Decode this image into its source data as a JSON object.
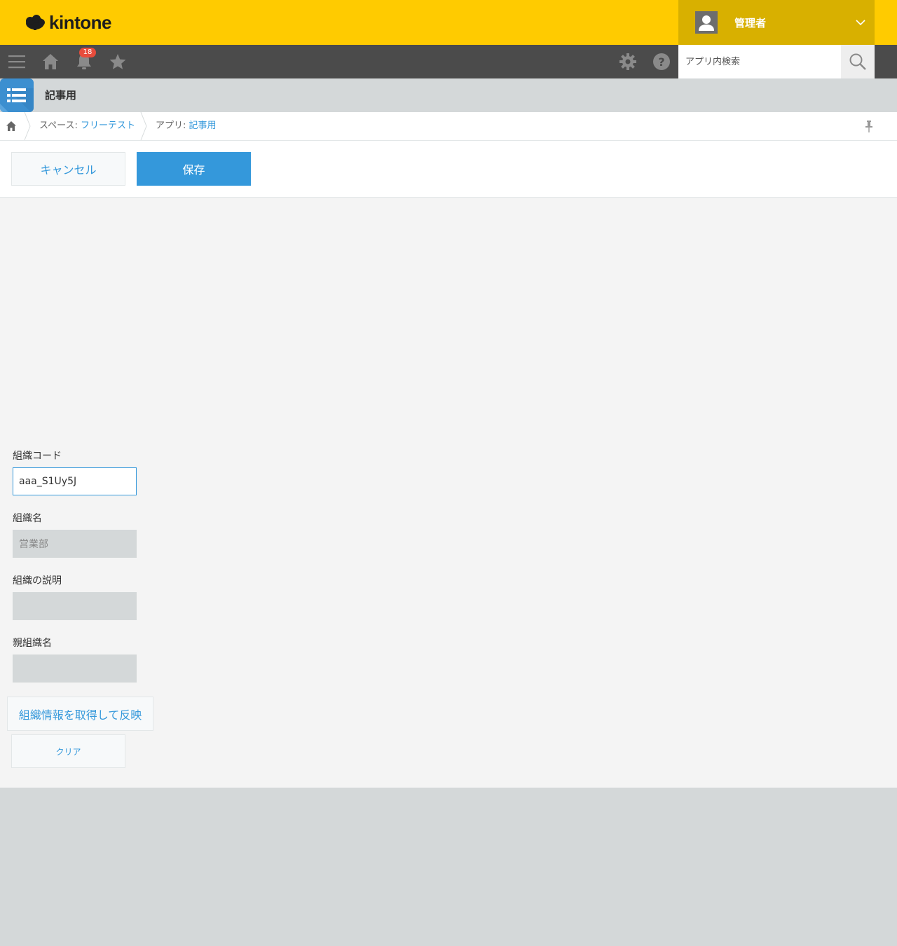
{
  "header": {
    "logo_text": "kintone",
    "user_name": "管理者"
  },
  "toolbar": {
    "notification_count": "18",
    "search_placeholder": "アプリ内検索"
  },
  "app": {
    "title": "記事用"
  },
  "breadcrumb": {
    "space_prefix": "スペース: ",
    "space_name": "フリーテスト",
    "app_prefix": "アプリ: ",
    "app_name": "記事用"
  },
  "actions": {
    "cancel_label": "キャンセル",
    "save_label": "保存"
  },
  "form": {
    "org_code_label": "組織コード",
    "org_code_value": "aaa_S1Uy5J",
    "org_name_label": "組織名",
    "org_name_value": "営業部",
    "org_desc_label": "組織の説明",
    "org_desc_value": "",
    "parent_org_label": "親組織名",
    "parent_org_value": "",
    "fetch_button_label": "組織情報を取得して反映",
    "clear_button_label": "クリア"
  },
  "colors": {
    "header": "#ffcb00",
    "user_box": "#d8b000",
    "toolbar": "#4b4b4b",
    "accent": "#3498db",
    "badge": "#e74c3c"
  }
}
